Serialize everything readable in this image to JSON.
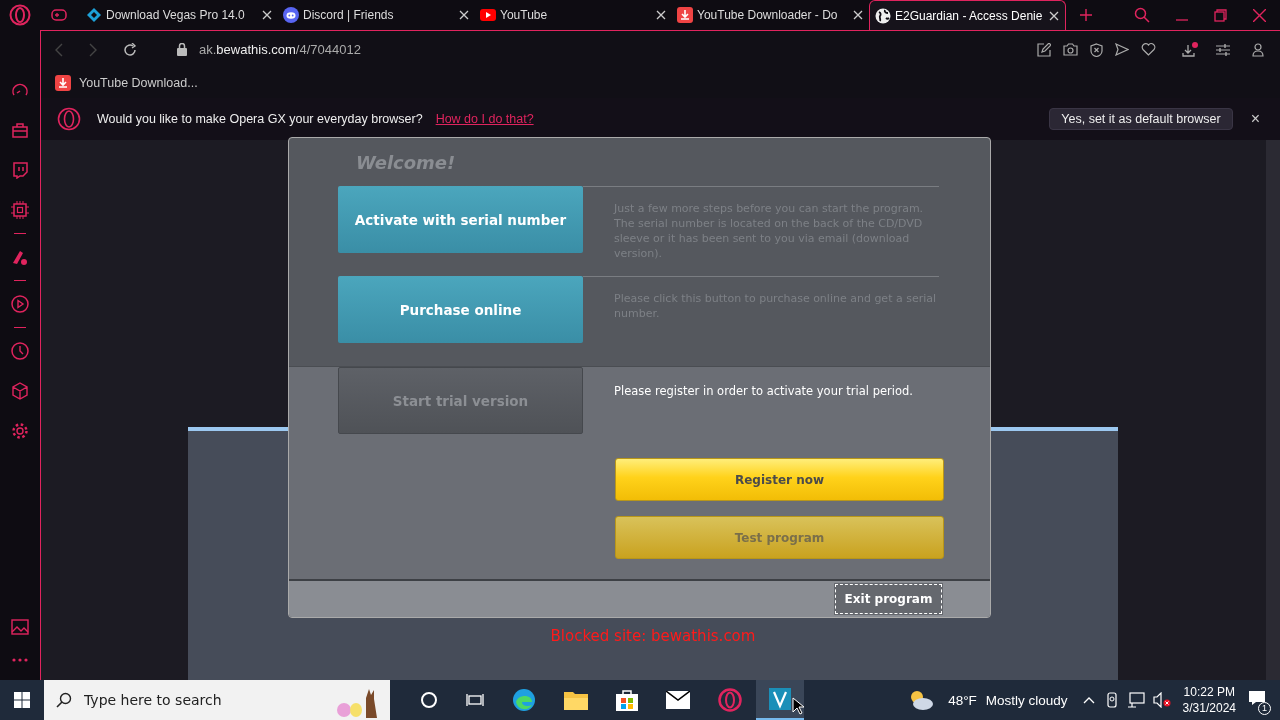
{
  "tabs": [
    {
      "kind": "vegas",
      "title": "Download Vegas Pro 14.0",
      "selected": false
    },
    {
      "kind": "discord",
      "title": "Discord | Friends",
      "selected": false
    },
    {
      "kind": "youtube",
      "title": "YouTube",
      "selected": false
    },
    {
      "kind": "downloader",
      "title": "YouTube Downloader - Do",
      "selected": false
    },
    {
      "kind": "globe",
      "title": "E2Guardian - Access Denie",
      "selected": true
    }
  ],
  "address": {
    "host_prefix": "ak.",
    "host": "bewathis.com",
    "path": "/4/7044012"
  },
  "bookmarks": [
    {
      "title": "YouTube Download..."
    }
  ],
  "infobar": {
    "message": "Would you like to make Opera GX your everyday browser?",
    "link": "How do I do that?",
    "button": "Yes, set it as default browser",
    "close": "×"
  },
  "page": {
    "blocked_site": "Blocked site: bewathis.com"
  },
  "dialog": {
    "title": "Welcome!",
    "options": [
      {
        "kind": "teal",
        "label": "Activate with serial number",
        "description": "Just a few more steps before you can start the program. The serial number is located on the back of the CD/DVD sleeve or it has been sent to you via email (download version).",
        "disabled": false
      },
      {
        "kind": "teal",
        "label": "Purchase online",
        "description": "Please click this button to purchase online and get a serial number.",
        "disabled": false
      },
      {
        "kind": "trial",
        "label": "Start trial version",
        "description": "Please register in order to activate your trial period.",
        "disabled": true
      }
    ],
    "actions": [
      {
        "label": "Register now",
        "disabled": false
      },
      {
        "label": "Test program",
        "disabled": true
      }
    ],
    "exit": {
      "label": "Exit program",
      "focused": true
    }
  },
  "taskbar": {
    "search_placeholder": "Type here to search",
    "temperature": "48°F",
    "weather": "Mostly cloudy",
    "time": "10:22 PM",
    "date": "3/31/2024",
    "notifications": "1"
  }
}
